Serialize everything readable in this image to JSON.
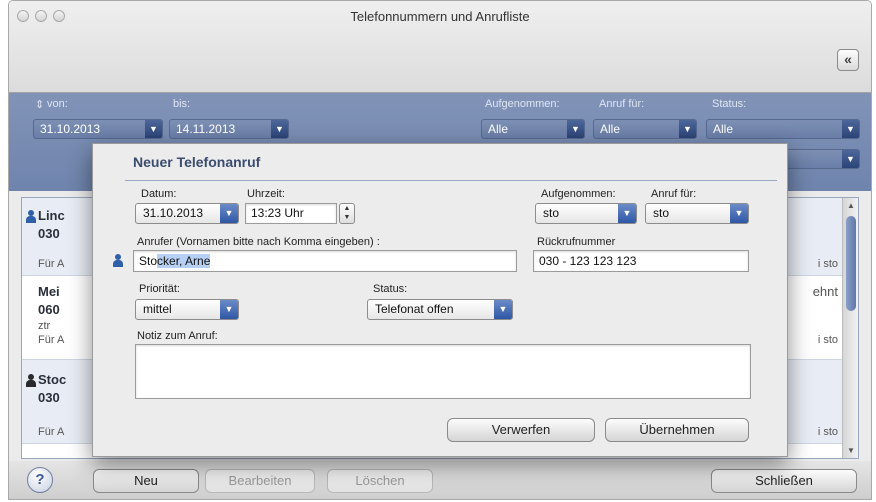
{
  "window": {
    "title": "Telefonnummern und Anrufliste",
    "collapse_glyph": "«"
  },
  "filters": {
    "von_label": "von:",
    "bis_label": "bis:",
    "von_value": "31.10.2013",
    "bis_value": "14.11.2013",
    "aufgenommen_label": "Aufgenommen:",
    "aufgenommen_value": "Alle",
    "anruf_fuer_label": "Anruf für:",
    "anruf_fuer_value": "Alle",
    "status_label": "Status:",
    "status_value": "Alle",
    "sort_glyph": "⇕"
  },
  "list": {
    "entries": [
      {
        "name": "Linc",
        "phone": "030",
        "sub": "Für A",
        "right": "i sto"
      },
      {
        "name": "Mei",
        "phone": "060",
        "sub1": "ztr",
        "sub": "Für A",
        "right_top": "ehnt",
        "right": "i sto"
      },
      {
        "name": "Stoc",
        "phone": "030",
        "sub": "Für A",
        "right": "i sto"
      }
    ]
  },
  "dialog": {
    "title": "Neuer Telefonanruf",
    "datum_label": "Datum:",
    "datum_value": "31.10.2013",
    "uhrzeit_label": "Uhrzeit:",
    "uhrzeit_value": "13:23 Uhr",
    "aufgenommen_label": "Aufgenommen:",
    "aufgenommen_value": "sto",
    "anruf_fuer_label": "Anruf für:",
    "anruf_fuer_value": "sto",
    "anrufer_label": "Anrufer (Vornamen bitte nach Komma eingeben) :",
    "anrufer_typed": "Sto",
    "anrufer_selected": "cker, Arne",
    "rueckruf_label": "Rückrufnummer",
    "rueckruf_value": "030 - 123 123 123",
    "prioritaet_label": "Priorität:",
    "prioritaet_value": "mittel",
    "status_label": "Status:",
    "status_value": "Telefonat offen",
    "notiz_label": "Notiz zum Anruf:",
    "notiz_value": "",
    "verwerfen_label": "Verwerfen",
    "uebernehmen_label": "Übernehmen"
  },
  "bottom": {
    "help_label": "?",
    "neu_label": "Neu",
    "bearbeiten_label": "Bearbeiten",
    "loeschen_label": "Löschen",
    "schliessen_label": "Schließen"
  }
}
